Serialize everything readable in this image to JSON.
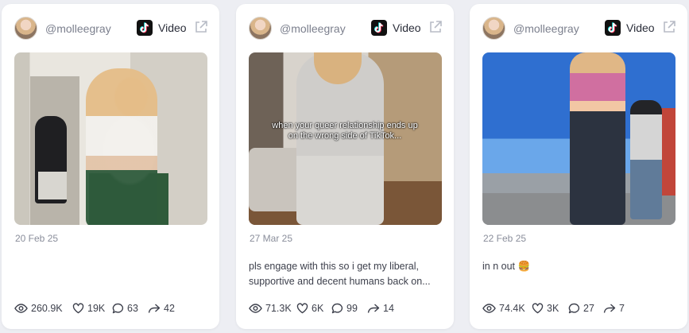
{
  "cards": [
    {
      "handle": "@molleegray",
      "platform_label": "Video",
      "date": "20 Feb 25",
      "description": [],
      "stats": {
        "views": "260.9K",
        "likes": "19K",
        "comments": "63",
        "shares": "42"
      },
      "caption_overlay": ""
    },
    {
      "handle": "@molleegray",
      "platform_label": "Video",
      "date": "27 Mar 25",
      "description": [
        "pls engage with this so i get my liberal,",
        "supportive and decent humans back on..."
      ],
      "stats": {
        "views": "71.3K",
        "likes": "6K",
        "comments": "99",
        "shares": "14"
      },
      "caption_overlay": "when your queer relationship ends up on the wrong side of TikTok..."
    },
    {
      "handle": "@molleegray",
      "platform_label": "Video",
      "date": "22 Feb 25",
      "description": [
        "in n out 🍔"
      ],
      "stats": {
        "views": "74.4K",
        "likes": "3K",
        "comments": "27",
        "shares": "7"
      },
      "caption_overlay": ""
    }
  ],
  "icons": {
    "platform": "tiktok-icon",
    "open": "external-link-icon",
    "views": "eye-icon",
    "likes": "heart-icon",
    "comments": "comment-icon",
    "shares": "share-icon"
  },
  "colors": {
    "background": "#edeef3",
    "card": "#ffffff",
    "muted_text": "#8a8e9b",
    "text": "#3d404c"
  }
}
